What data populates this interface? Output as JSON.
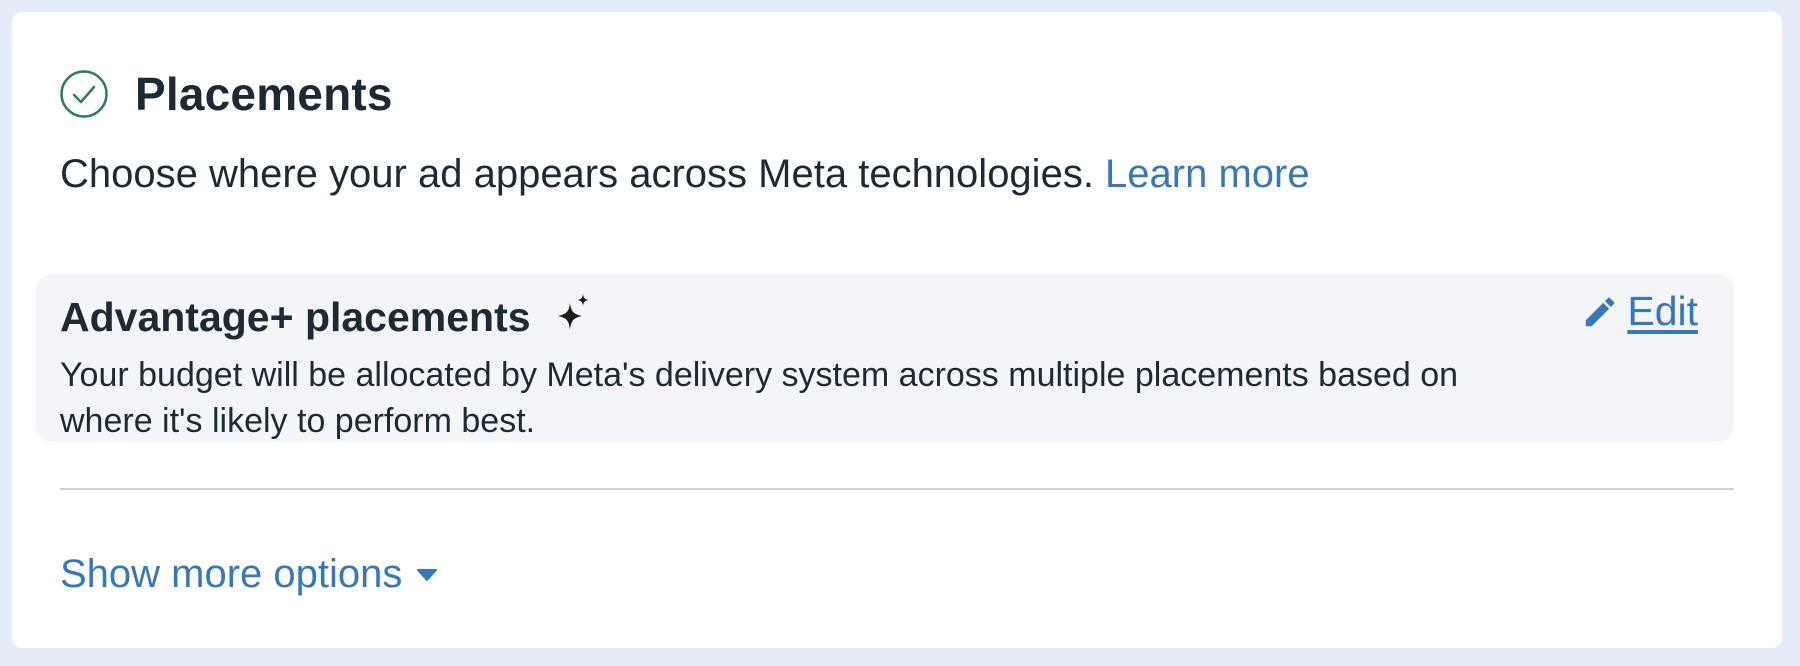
{
  "section": {
    "title": "Placements",
    "description": "Choose where your ad appears across Meta technologies.",
    "learn_more_label": "Learn more"
  },
  "advantage": {
    "title": "Advantage+ placements",
    "edit_label": "Edit",
    "description": "Your budget will be allocated by Meta's delivery system across multiple placements based on where it's likely to perform best."
  },
  "show_more": {
    "label": "Show more options"
  },
  "icons": {
    "status": "check-circle-icon",
    "advantage": "sparkle-icon",
    "edit": "pencil-icon",
    "show_more": "caret-down-icon"
  },
  "colors": {
    "link": "#3578bd",
    "text": "#1c2b33",
    "success": "#31a24c",
    "panel": "#f3f5f8",
    "background": "#e3ecf7"
  }
}
